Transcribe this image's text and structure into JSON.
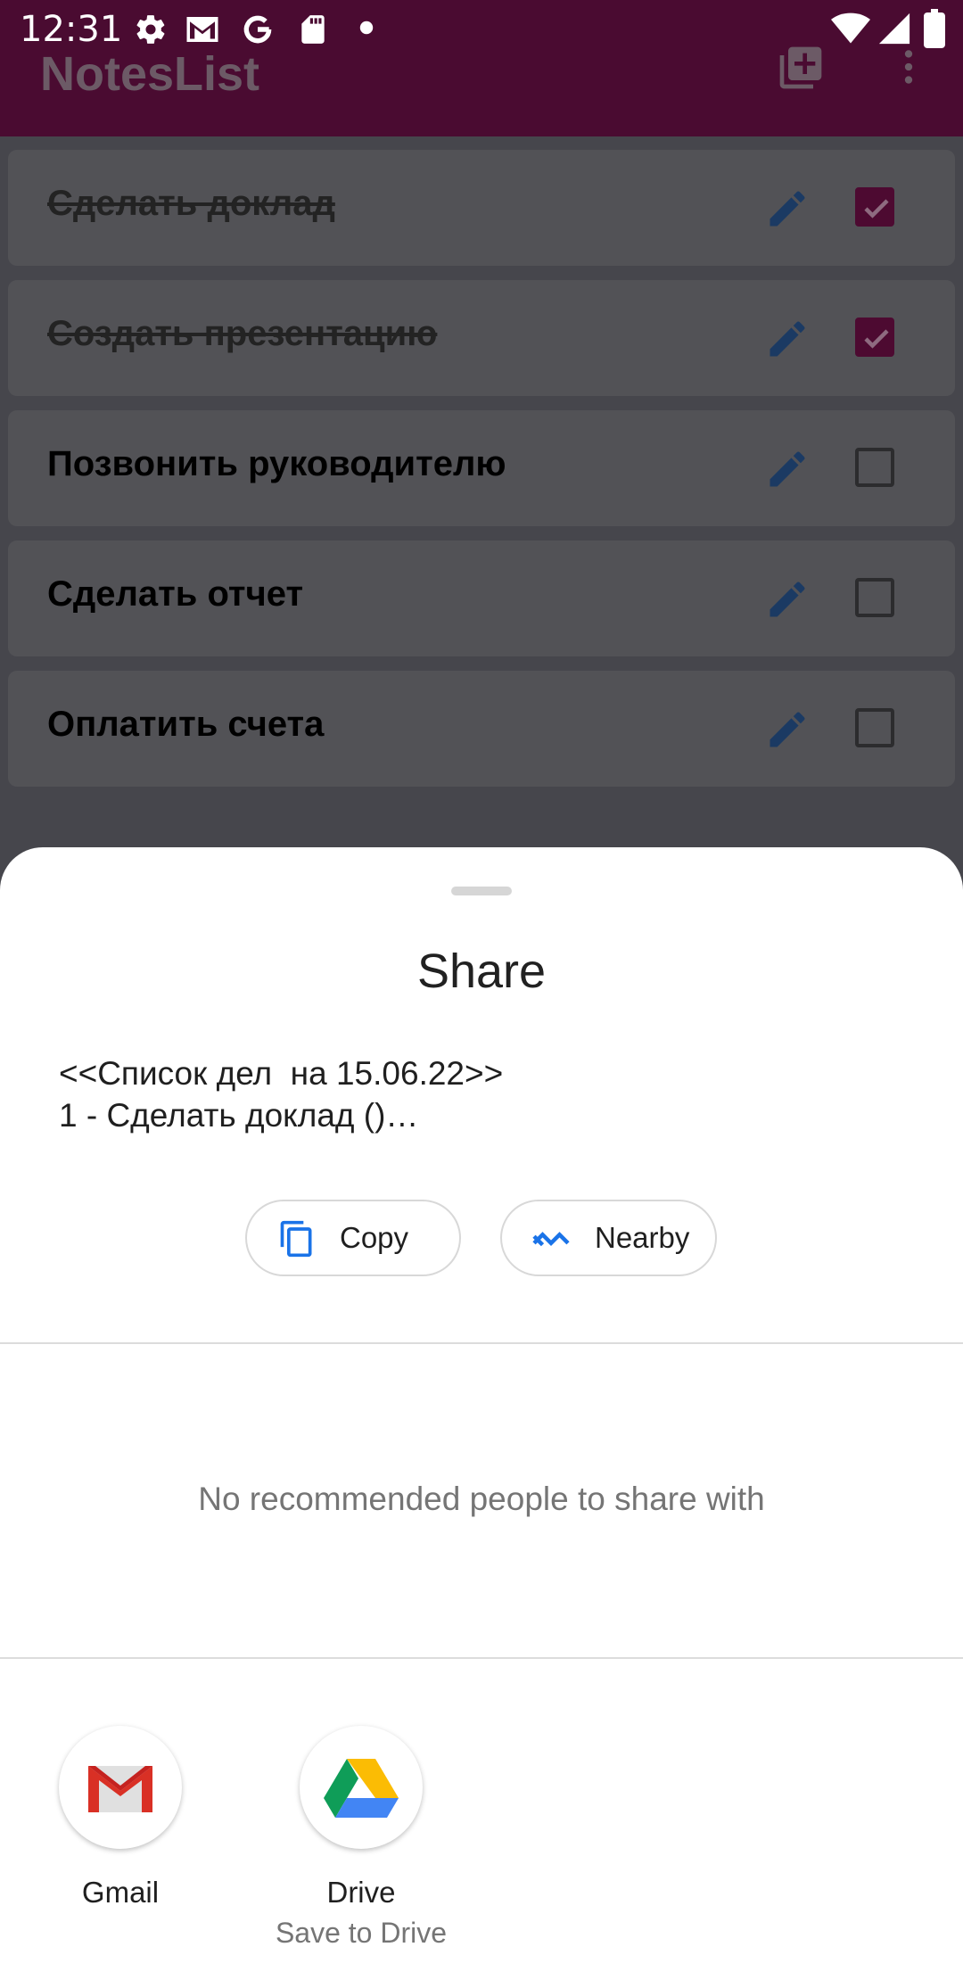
{
  "status_bar": {
    "time": "12:31"
  },
  "app_bar": {
    "title": "NotesList"
  },
  "notes": [
    {
      "label": "Сделать доклад",
      "checked": true
    },
    {
      "label": "Создать презентацию",
      "checked": true
    },
    {
      "label": "Позвонить руководителю",
      "checked": false
    },
    {
      "label": "Сделать отчет",
      "checked": false
    },
    {
      "label": "Оплатить счета",
      "checked": false
    }
  ],
  "share_sheet": {
    "title": "Share",
    "preview_line1": "<<Список дел  на 15.06.22>>",
    "preview_line2": "1 - Сделать доклад ()…",
    "copy_label": "Copy",
    "nearby_label": "Nearby",
    "no_people_text": "No recommended people to share with",
    "targets": [
      {
        "name": "Gmail",
        "subtitle": ""
      },
      {
        "name": "Drive",
        "subtitle": "Save to Drive"
      }
    ]
  },
  "colors": {
    "accent": "#4a0b31",
    "check": "#4d0a31",
    "chip_icon": "#1a73e8"
  }
}
